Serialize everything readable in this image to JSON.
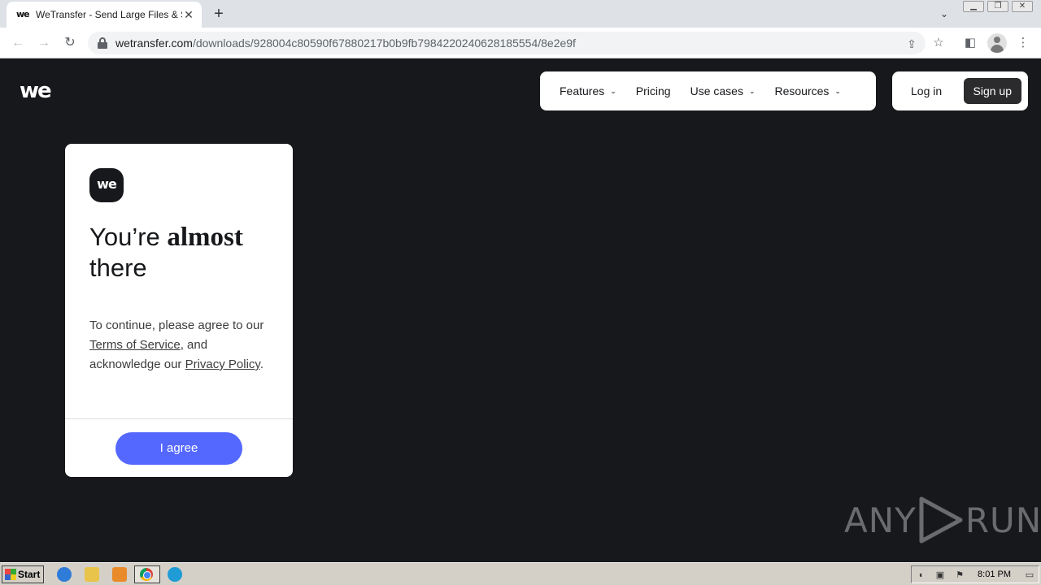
{
  "browser": {
    "tab_title": "WeTransfer - Send Large Files & Sha",
    "tab_favicon": "we",
    "url_domain": "wetransfer.com",
    "url_path": "/downloads/928004c80590f67880217b0b9fb7984220240628185554/8e2e9f",
    "icons": [
      "back-arrow-icon",
      "forward-arrow-icon",
      "reload-icon",
      "lock-icon",
      "share-icon",
      "star-icon",
      "side-panel-icon",
      "profile-icon",
      "kebab-menu-icon"
    ]
  },
  "site": {
    "logo": "we",
    "nav": [
      {
        "label": "Features",
        "dropdown": true
      },
      {
        "label": "Pricing",
        "dropdown": false
      },
      {
        "label": "Use cases",
        "dropdown": true
      },
      {
        "label": "Resources",
        "dropdown": true
      }
    ],
    "login_label": "Log in",
    "signup_label": "Sign up"
  },
  "card": {
    "logo": "we",
    "title_prefix": "You’re ",
    "title_strong": "almost",
    "title_suffix": "there",
    "text_1": "To continue, please agree to our ",
    "terms_link": "Terms of Service",
    "text_2": ", and acknowledge our ",
    "privacy_link": "Privacy Policy",
    "text_3": ".",
    "agree_label": "I agree"
  },
  "watermark": {
    "left": "ANY",
    "right": "RUN"
  },
  "taskbar": {
    "start_label": "Start",
    "clock": "8:01 PM"
  },
  "colors": {
    "page_bg": "#17181b",
    "accent": "#5468ff",
    "signup_bg": "#2b2b2d"
  }
}
